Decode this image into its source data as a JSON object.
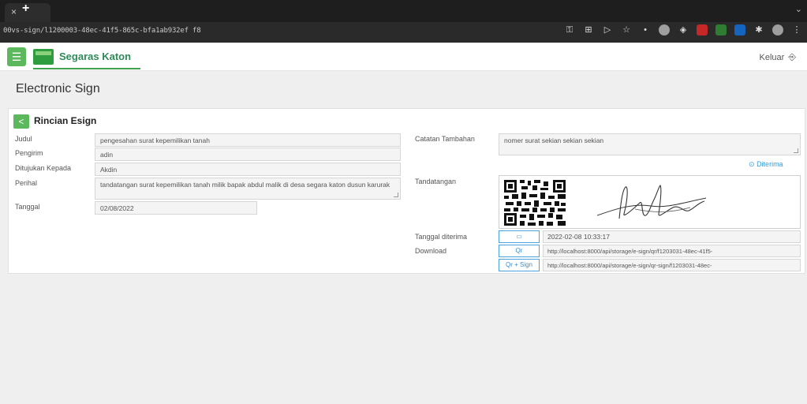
{
  "browser": {
    "tab_close": "×",
    "tab_new": "+",
    "url": "00vs-sign/l1200003-48ec-41f5-865c-bfa1ab932ef f8"
  },
  "app": {
    "menu_glyph": "☰",
    "brand": "Segaras Katon",
    "logout_label": "Keluar",
    "logout_glyph": "⎆",
    "accent": "#5cb85c"
  },
  "page": {
    "title": "Electronic Sign"
  },
  "panel": {
    "title": "Rincian Esign",
    "back_glyph": "<",
    "left_fields": [
      {
        "label": "Judul",
        "value": "pengesahan surat kepemilikan tanah"
      },
      {
        "label": "Pengirim",
        "value": "adin"
      },
      {
        "label": "Ditujukan Kepada",
        "value": "Akdin"
      },
      {
        "label": "Perihal",
        "value": "tandatangan surat kepemilikan tanah milik bapak abdul malik di desa segara katon dusun karurak"
      },
      {
        "label": "Tanggal",
        "value": "02/08/2022"
      }
    ],
    "notes": {
      "label": "Catatan Tambahan",
      "value": "nomer surat sekian sekian sekian"
    },
    "accepted_label": "Diterima",
    "signature_label": "Tandatangan",
    "received": {
      "label": "Tanggal diterima",
      "icon": "calendar-icon",
      "value": "2022-02-08 10:33:17"
    },
    "download": {
      "label": "Download",
      "qr_button": "Qr",
      "qr_url": "http://localhost:8000/api/storage/e-sign/qr/f1203031-48ec-41f5-",
      "qrsign_button": "Qr + Sign",
      "qrsign_url": "http://localhost:8000/api/storage/e-sign/qr-sign/f1203031-48ec-"
    }
  }
}
